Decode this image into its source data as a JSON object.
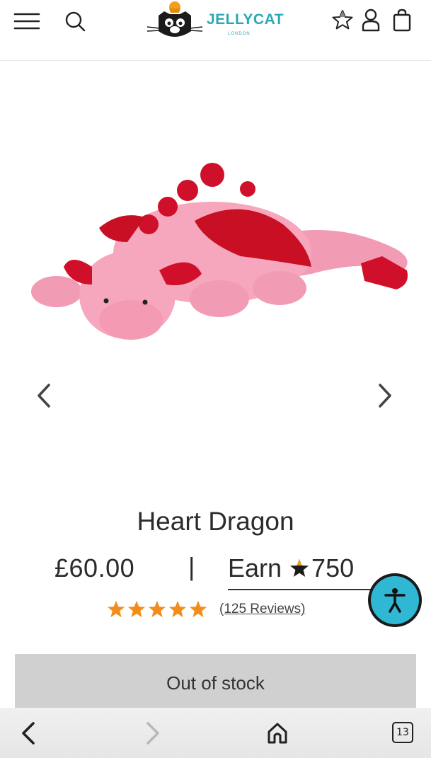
{
  "header": {
    "brand": "JELLYCAT",
    "brand_sub": "LONDON",
    "icons": [
      "menu-icon",
      "search-icon",
      "wishlist-star-icon",
      "account-icon",
      "bag-icon"
    ]
  },
  "gallery": {
    "prev_icon": "chevron-left-icon",
    "next_icon": "chevron-right-icon"
  },
  "product": {
    "title": "Heart Dragon",
    "price": "£60.00",
    "separator": "|",
    "earn_label": "Earn",
    "earn_points": "750",
    "rating_stars": 5,
    "reviews_label": "(125 Reviews)",
    "stock_button": "Out of stock"
  },
  "colors": {
    "brand": "#2aa9b5",
    "star": "#f28c1a",
    "accessibility": "#2fb7d3",
    "button_disabled": "#d0d0d0"
  },
  "browser": {
    "tab_count": "13"
  }
}
